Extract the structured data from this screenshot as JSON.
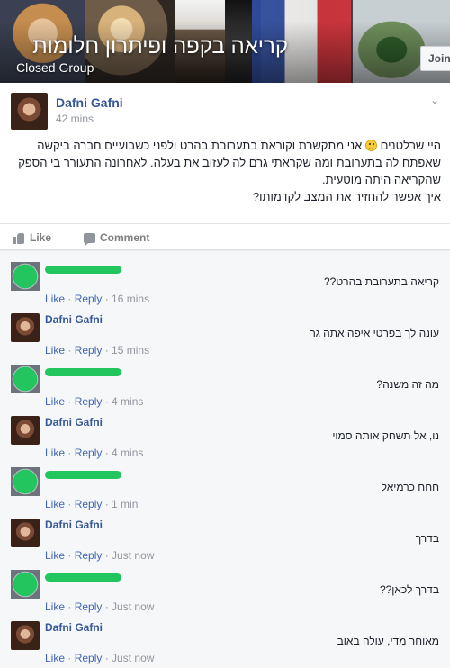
{
  "group": {
    "title": "קריאה בקפה ופיתרון חלומות",
    "subtitle": "Closed Group",
    "join_label": "Join"
  },
  "post": {
    "author": "Dafni Gafni",
    "time": "42 mins",
    "line1_a": "היי שרלטנים",
    "line1_b": "אני מתקשרת וקוראת בתערובת בהרט ולפני כשבועיים חברה ביקשה",
    "line2": "שאפתח לה בתערובת ומה שקראתי גרם לה לעזוב את בעלה. לאחרונה התעורר בי הספק",
    "line3": "שהקריאה היתה מוטעית.",
    "line4": "איך אפשר להחזיר את המצב לקדמותו?",
    "like_label": "Like",
    "comment_label": "Comment"
  },
  "comments": [
    {
      "author": "",
      "redacted": true,
      "text": "קריאה בתערובת בהרט??",
      "like": "Like",
      "reply": "Reply",
      "time": "16 mins"
    },
    {
      "author": "Dafni Gafni",
      "redacted": false,
      "text": "עונה לך בפרטי איפה אתה גר",
      "like": "Like",
      "reply": "Reply",
      "time": "15 mins"
    },
    {
      "author": "",
      "redacted": true,
      "text": "מה זה משנה?",
      "like": "Like",
      "reply": "Reply",
      "time": "4 mins"
    },
    {
      "author": "Dafni Gafni",
      "redacted": false,
      "text": "נו, אל תשחק אותה סמוי",
      "like": "Like",
      "reply": "Reply",
      "time": "4 mins"
    },
    {
      "author": "",
      "redacted": true,
      "text": "חחח כרמיאל",
      "like": "Like",
      "reply": "Reply",
      "time": "1 min"
    },
    {
      "author": "Dafni Gafni",
      "redacted": false,
      "text": "בדרך",
      "like": "Like",
      "reply": "Reply",
      "time": "Just now"
    },
    {
      "author": "",
      "redacted": true,
      "text": "בדרך לכאן??",
      "like": "Like",
      "reply": "Reply",
      "time": "Just now"
    },
    {
      "author": "Dafni Gafni",
      "redacted": false,
      "text": "מאוחר מדי, עולה באוב",
      "like": "Like",
      "reply": "Reply",
      "time": "Just now"
    }
  ],
  "colors": {
    "link": "#365899",
    "redaction_green": "#22c55e",
    "meta_gray": "#90949c"
  }
}
